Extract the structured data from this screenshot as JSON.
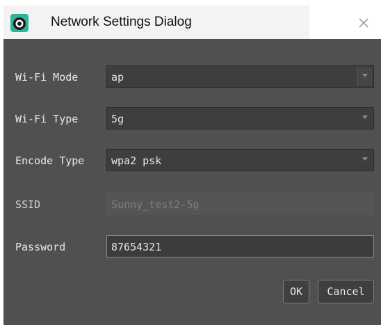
{
  "window": {
    "title": "Network Settings Dialog",
    "app_icon": "eye-app-icon",
    "close_icon": "close-icon"
  },
  "form": {
    "wifi_mode": {
      "label": "Wi-Fi Mode",
      "value": "ap",
      "icon": "chevron-down-icon"
    },
    "wifi_type": {
      "label": "Wi-Fi Type",
      "value": "5g",
      "icon": "chevron-down-icon"
    },
    "encode_type": {
      "label": "Encode Type",
      "value": "wpa2 psk",
      "icon": "chevron-down-icon"
    },
    "ssid": {
      "label": "SSID",
      "value": "Sunny_test2-5g",
      "disabled": true
    },
    "password": {
      "label": "Password",
      "value": "87654321"
    }
  },
  "buttons": {
    "ok_label": "OK",
    "cancel_label": "Cancel"
  },
  "colors": {
    "dialog_background": "#505050",
    "field_background": "#3e3e3e",
    "title_background": "#f3f3f3",
    "icon_accent": "#2fb39a"
  }
}
